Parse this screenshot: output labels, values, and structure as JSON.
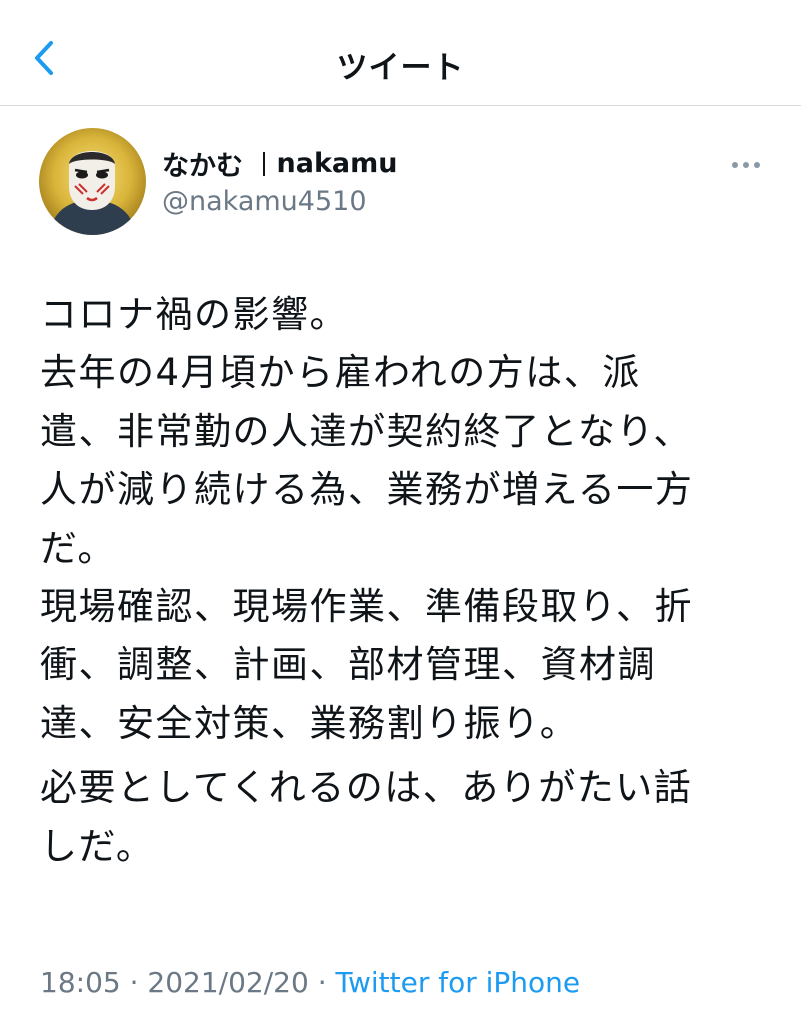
{
  "header": {
    "title": "ツイート",
    "back_icon": "chevron-left-icon"
  },
  "colors": {
    "accent": "#1d9bf0",
    "text": "#0f1419",
    "muted": "#6b7885",
    "divider": "#d9d9d9"
  },
  "author": {
    "display_name_part1": "なかむ",
    "display_name_part2": "nakamu",
    "handle": "@nakamu4510",
    "avatar_icon": "avatar-mask-icon",
    "more_icon": "more-horizontal-icon"
  },
  "tweet": {
    "paragraph1": "コロナ禍の影響。\n去年の4月頃から雇われの方は、派\n遣、非常勤の人達が契約終了となり、\n人が減り続ける為、業務が増える一方\nだ。\n現場確認、現場作業、準備段取り、折\n衝、調整、計画、部材管理、資材調\n達、安全対策、業務割り振り。",
    "paragraph2": "必要としてくれるのは、ありがたい話\nしだ。"
  },
  "meta": {
    "time": "18:05",
    "sep1": " · ",
    "date": "2021/02/20",
    "sep2": " · ",
    "source": "Twitter for iPhone"
  }
}
